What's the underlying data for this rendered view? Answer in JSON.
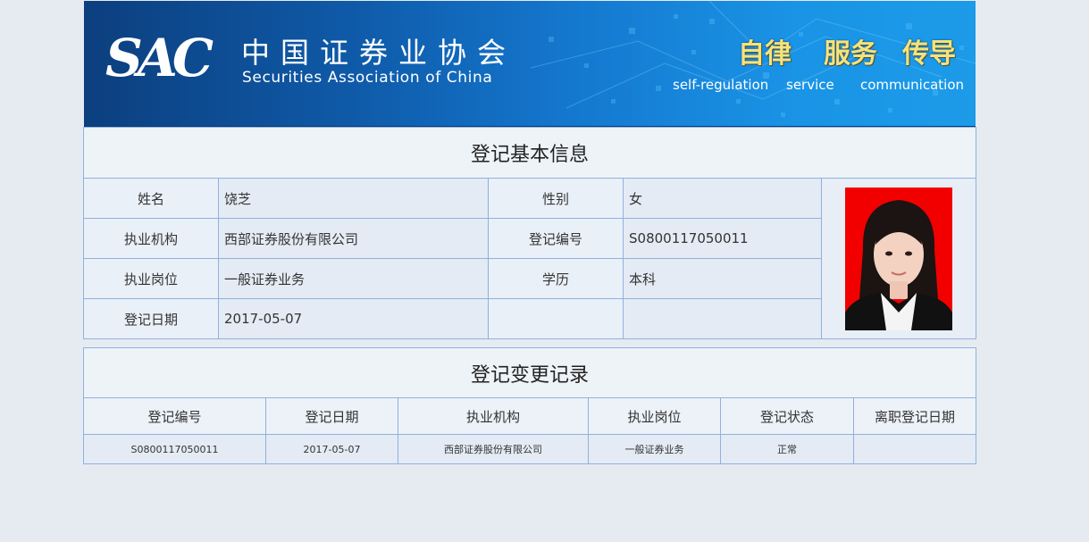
{
  "banner": {
    "logo": "SAC",
    "org_name_cn": "中国证券业协会",
    "org_name_en": "Securities Association of China",
    "slogans": [
      {
        "cn": "自律",
        "en": "self-regulation"
      },
      {
        "cn": "服务",
        "en": "service"
      },
      {
        "cn": "传导",
        "en": "communication"
      }
    ]
  },
  "basic_info": {
    "title": "登记基本信息",
    "name_label": "姓名",
    "name_value": "饶芝",
    "gender_label": "性别",
    "gender_value": "女",
    "org_label": "执业机构",
    "org_value": "西部证券股份有限公司",
    "reg_no_label": "登记编号",
    "reg_no_value": "S0800117050011",
    "position_label": "执业岗位",
    "position_value": "一般证券业务",
    "education_label": "学历",
    "education_value": "本科",
    "reg_date_label": "登记日期",
    "reg_date_value": "2017-05-07"
  },
  "change_records": {
    "title": "登记变更记录",
    "headers": [
      "登记编号",
      "登记日期",
      "执业机构",
      "执业岗位",
      "登记状态",
      "离职登记日期"
    ],
    "rows": [
      [
        "S0800117050011",
        "2017-05-07",
        "西部证券股份有限公司",
        "一般证券业务",
        "正常",
        ""
      ]
    ]
  }
}
